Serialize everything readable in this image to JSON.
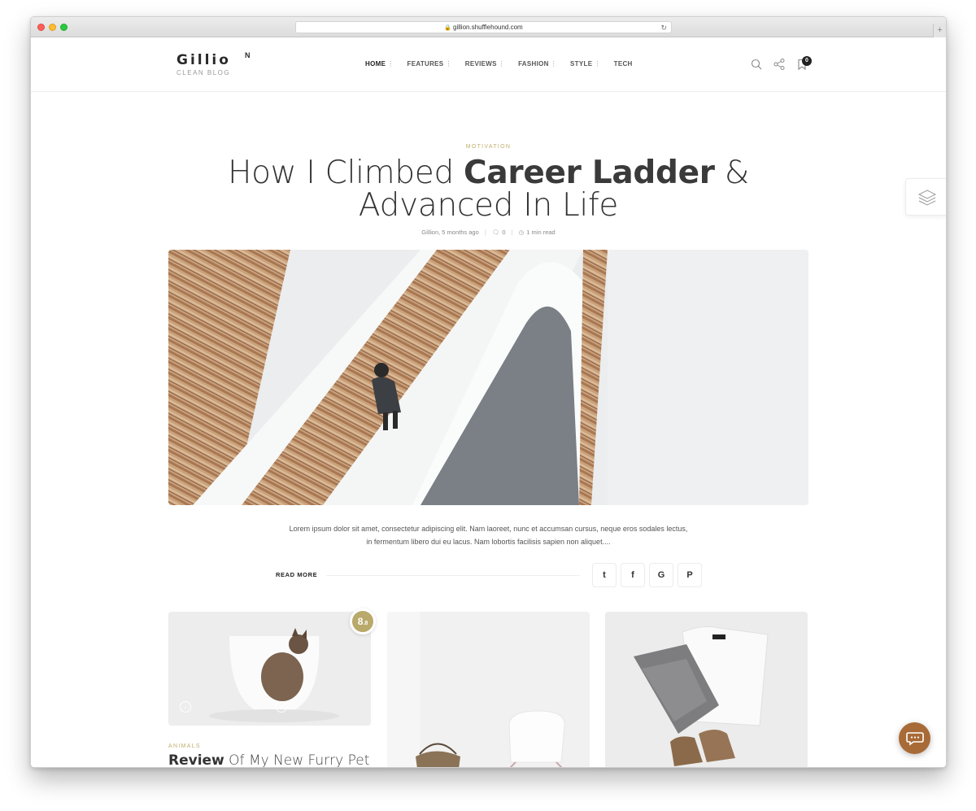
{
  "browser": {
    "url": "gillion.shufflehound.com"
  },
  "header": {
    "logo_name": "Gillio",
    "logo_sup": "N",
    "logo_tagline": "CLEAN BLOG",
    "nav": [
      {
        "label": "HOME",
        "has_menu": true
      },
      {
        "label": "FEATURES",
        "has_menu": true
      },
      {
        "label": "REVIEWS",
        "has_menu": true
      },
      {
        "label": "FASHION",
        "has_menu": true
      },
      {
        "label": "STYLE",
        "has_menu": true
      },
      {
        "label": "TECH",
        "has_menu": false
      }
    ],
    "menu_marker": "⋮",
    "cart_count": "0",
    "icons": [
      "search-icon",
      "share-icon",
      "bookmark-icon"
    ]
  },
  "hero": {
    "category": "MOTIVATION",
    "title_light_1": "How I Climbed ",
    "title_bold": "Career Ladder",
    "title_light_2": " &",
    "title_line_2": "Advanced In Life",
    "author_time": "Gillion, 5 months ago",
    "comments": "0",
    "read_time": "1 min read",
    "excerpt_line_1": "Lorem ipsum dolor sit amet, consectetur adipiscing elit. Nam laoreet, nunc et accumsan cursus, neque eros sodales lectus,",
    "excerpt_line_2": "in fermentum libero dui eu lacus. Nam lobortis facilisis sapien non aliquet....",
    "read_more": "READ MORE",
    "share_icons": [
      "twitter-icon",
      "facebook-icon",
      "google-icon",
      "pinterest-icon"
    ],
    "share_glyphs": {
      "twitter": "t",
      "facebook": "f",
      "google": "G",
      "pinterest": "P"
    }
  },
  "cards": {
    "card1": {
      "score": "8",
      "score_decimal": ".8",
      "category": "ANIMALS",
      "title_bold": "Review",
      "title_light": " Of My New Furry Pet Friend"
    }
  },
  "colors": {
    "accent_gold": "#c0ae6e",
    "score_badge": "#b9a96a",
    "chat_button": "#a86a37"
  }
}
